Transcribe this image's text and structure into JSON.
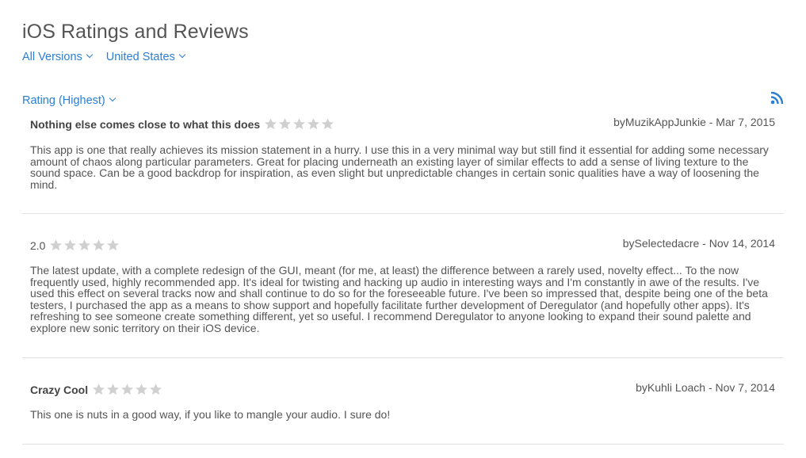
{
  "header": {
    "title": "iOS Ratings and Reviews",
    "versions_filter": "All Versions",
    "country_filter": "United States",
    "sort_label": "Rating (Highest)",
    "rss_icon": "rss-icon"
  },
  "colors": {
    "link": "#2a7fd4",
    "star_empty": "#d0d0d0",
    "divider": "#e2e2e2"
  },
  "reviews": [
    {
      "title": "Nothing else comes close to what this does",
      "stars_filled": 0,
      "byline": "byMuzikAppJunkie - Mar 7, 2015",
      "body": "This app is one that really achieves its mission statement in a hurry. I use this in a very minimal way but still find it essential for adding some necessary amount of chaos along particular parameters. Great for placing underneath an existing layer of similar effects to add a sense of living texture to the sound space. Can be a good backdrop for inspiration, as even slight but unpredictable changes in certain sonic qualities have a way of loosening the mind."
    },
    {
      "title": "2.0",
      "stars_filled": 0,
      "byline": "bySelectedacre - Nov 14, 2014",
      "body": "The latest update, with a complete redesign of the GUI, meant (for me, at least) the difference between a rarely used, novelty effect... To the now frequently used, highly recommended app. It's ideal for twisting and hacking up audio in interesting ways and I'm constantly in awe of the results. I've used this effect on several tracks now and shall continue to do so for the foreseeable future. I've been so impressed that, despite being one of the beta testers, I purchased the app as a means to show support and hopefully facilitate further development of Deregulator (and hopefully other apps). It's refreshing to see someone create something different, yet so useful. I recommend Deregulator to anyone looking to expand their sound palette and explore new sonic territory on their iOS device."
    },
    {
      "title": "Crazy Cool",
      "stars_filled": 0,
      "byline": "byKuhli Loach - Nov 7, 2014",
      "body": "This one is nuts in a good way, if you like to mangle your audio. I sure do!"
    }
  ]
}
